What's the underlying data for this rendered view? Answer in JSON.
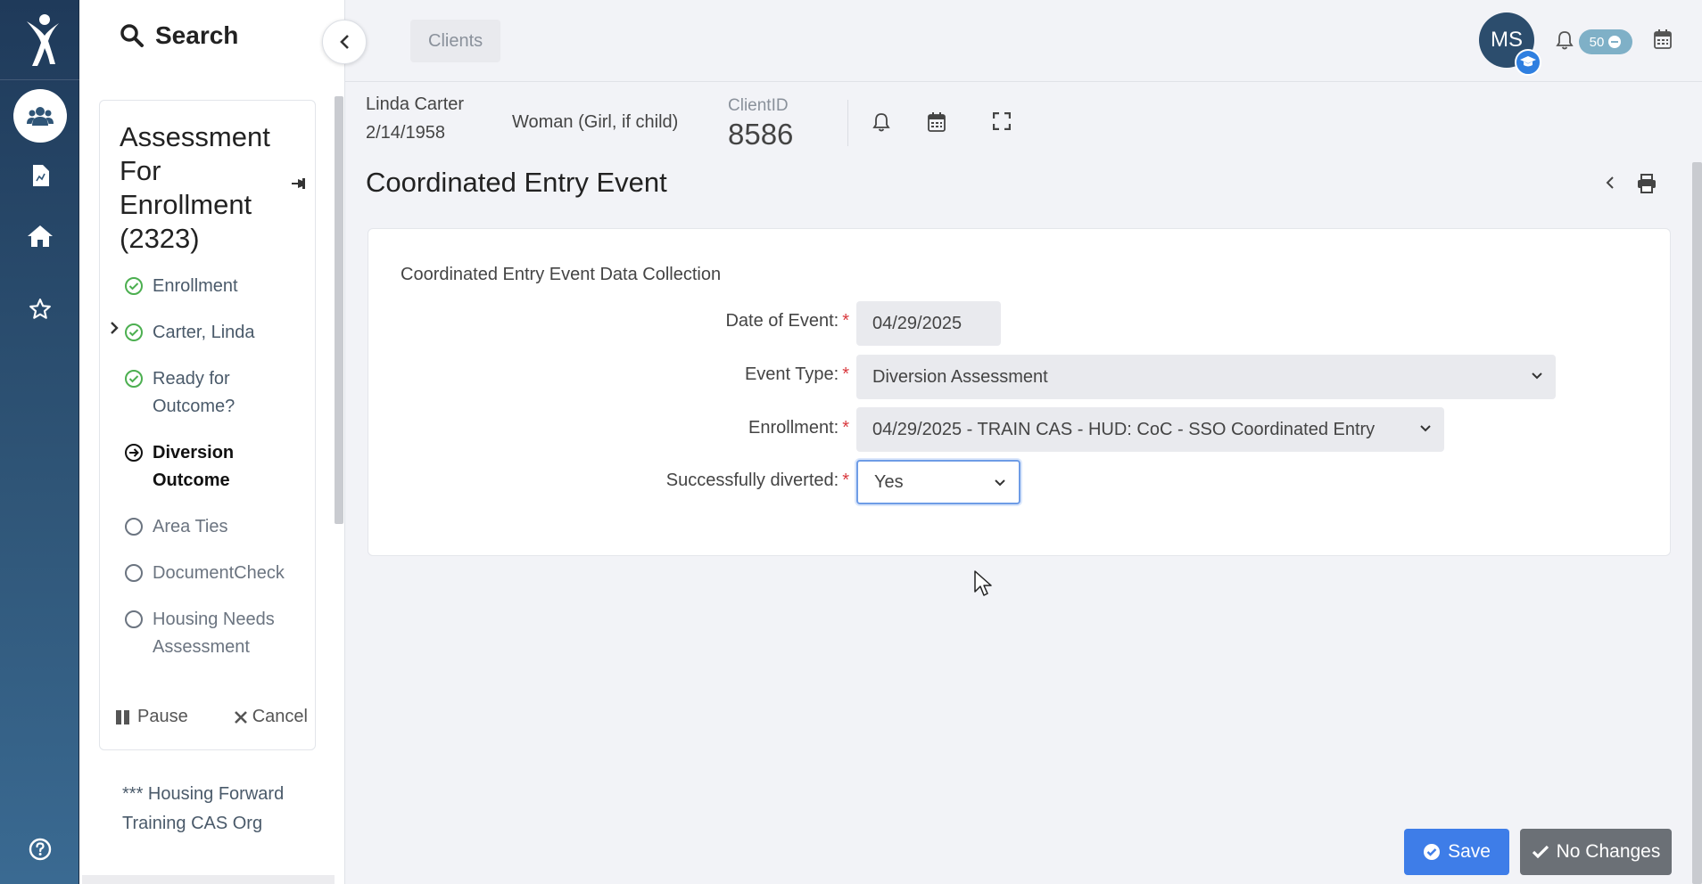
{
  "search": {
    "label": "Search"
  },
  "breadcrumb": {
    "item": "Clients"
  },
  "user": {
    "initials": "MS",
    "notification_count": "50"
  },
  "workflow": {
    "title": "Assessment For Enrollment (2323)",
    "steps": [
      {
        "label": "Enrollment",
        "status": "done"
      },
      {
        "label": "Carter, Linda",
        "status": "done"
      },
      {
        "label": "Ready for Outcome?",
        "status": "done"
      },
      {
        "label": "Diversion Outcome",
        "status": "current"
      },
      {
        "label": "Area Ties",
        "status": "todo"
      },
      {
        "label": "DocumentCheck",
        "status": "todo"
      },
      {
        "label": "Housing Needs Assessment",
        "status": "todo"
      }
    ],
    "pause_label": "Pause",
    "cancel_label": "Cancel"
  },
  "organization": "*** Housing Forward Training CAS Org",
  "client": {
    "name": "Linda Carter",
    "dob": "2/14/1958",
    "gender": "Woman (Girl, if child)",
    "id_label": "ClientID",
    "id": "8586"
  },
  "page": {
    "title": "Coordinated Entry Event"
  },
  "form": {
    "section": "Coordinated Entry Event Data Collection",
    "date_label": "Date of Event:",
    "date_value": "04/29/2025",
    "event_type_label": "Event Type:",
    "event_type_value": "Diversion Assessment",
    "enrollment_label": "Enrollment:",
    "enrollment_value": "04/29/2025 - TRAIN CAS - HUD: CoC - SSO Coordinated Entry",
    "diverted_label": "Successfully diverted:",
    "diverted_value": "Yes",
    "required_mark": "*"
  },
  "actions": {
    "save": "Save",
    "no_changes": "No Changes"
  },
  "colors": {
    "primary": "#3e7de8",
    "rail": "#2f5577",
    "required": "#d9393e",
    "done_check": "#4caf50"
  }
}
